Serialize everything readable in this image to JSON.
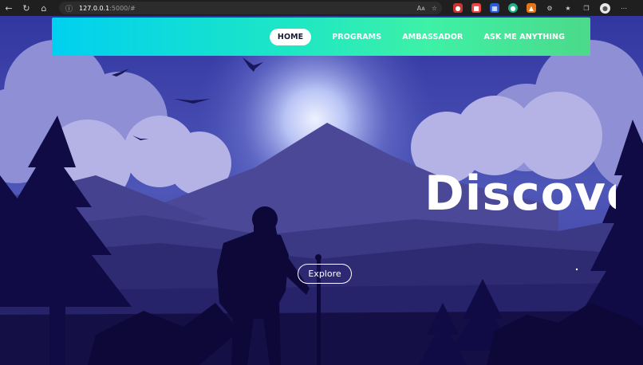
{
  "browser": {
    "url_host": "127.0.0.1",
    "url_rest": ":5000/#",
    "reader_label": "Aᴀ"
  },
  "navbar": {
    "items": [
      {
        "label": "HOME",
        "active": true
      },
      {
        "label": "PROGRAMS",
        "active": false
      },
      {
        "label": "AMBASSADOR",
        "active": false
      },
      {
        "label": "ASK ME ANYTHING",
        "active": false
      }
    ]
  },
  "hero": {
    "title": "Discover",
    "button_label": "Explore"
  },
  "colors": {
    "sky_top": "#3a3fa0",
    "glow": "#c9d4ff",
    "mountain": "#3f3d8c",
    "foreground": "#0f0a3d",
    "navbar_start": "#00d0f0",
    "navbar_end": "#4cd98a"
  }
}
